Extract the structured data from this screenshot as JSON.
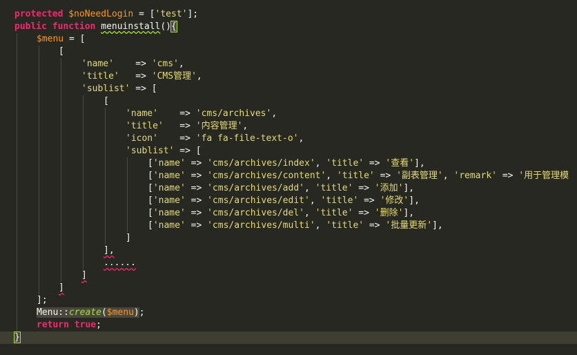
{
  "editor": {
    "theme": "monokai",
    "colors": {
      "background": "#272822",
      "keyword": "#f92672",
      "variable": "#fd971f",
      "string": "#e6db74",
      "function": "#a6e22e",
      "text": "#f8f8f2"
    }
  },
  "code": {
    "l1_kw": "protected",
    "l1_var": "$noNeedLogin",
    "l1_op": " = [",
    "l1_str": "'test'",
    "l1_end": "];",
    "l2_kw1": "public",
    "l2_kw2": "function",
    "l2_fn": "menuinstall",
    "l2_paren": "()",
    "l2_brace": "{",
    "l3_var": "$menu",
    "l3_op": " = [",
    "l4": "[",
    "l5_key": "'name'",
    "l5_arrow": "    => ",
    "l5_val": "'cms'",
    "l5_end": ",",
    "l6_key": "'title'",
    "l6_arrow": "   => ",
    "l6_val": "'CMS管理'",
    "l6_end": ",",
    "l7_key": "'sublist'",
    "l7_arrow": " => [",
    "l8": "[",
    "l9_key": "'name'",
    "l9_arrow": "    => ",
    "l9_val": "'cms/archives'",
    "l9_end": ",",
    "l10_key": "'title'",
    "l10_arrow": "   => ",
    "l10_val": "'内容管理'",
    "l10_end": ",",
    "l11_key": "'icon'",
    "l11_arrow": "    => ",
    "l11_val": "'fa fa-file-text-o'",
    "l11_end": ",",
    "l12_key": "'sublist'",
    "l12_arrow": " => [",
    "l13": [
      "[",
      "'name'",
      " => ",
      "'cms/archives/index'",
      ", ",
      "'title'",
      " => ",
      "'查看'",
      "],"
    ],
    "l14": [
      "[",
      "'name'",
      " => ",
      "'cms/archives/content'",
      ", ",
      "'title'",
      " => ",
      "'副表管理'",
      ", ",
      "'remark'",
      " => ",
      "'用于管理模"
    ],
    "l15": [
      "[",
      "'name'",
      " => ",
      "'cms/archives/add'",
      ", ",
      "'title'",
      " => ",
      "'添加'",
      "],"
    ],
    "l16": [
      "[",
      "'name'",
      " => ",
      "'cms/archives/edit'",
      ", ",
      "'title'",
      " => ",
      "'修改'",
      "],"
    ],
    "l17": [
      "[",
      "'name'",
      " => ",
      "'cms/archives/del'",
      ", ",
      "'title'",
      " => ",
      "'删除'",
      "],"
    ],
    "l18": [
      "[",
      "'name'",
      " => ",
      "'cms/archives/multi'",
      ", ",
      "'title'",
      " => ",
      "'批量更新'",
      "],"
    ],
    "l19": "]",
    "l20": "],",
    "l21": "......",
    "l22": "]",
    "l23": "]",
    "l24": "];",
    "l25_cls": "Menu::",
    "l25_fn": "create",
    "l25_open": "(",
    "l25_var": "$menu",
    "l25_close": ")",
    "l25_end": ";",
    "l26_kw": "return",
    "l26_val": "true",
    "l26_end": ";",
    "l27": "}"
  }
}
